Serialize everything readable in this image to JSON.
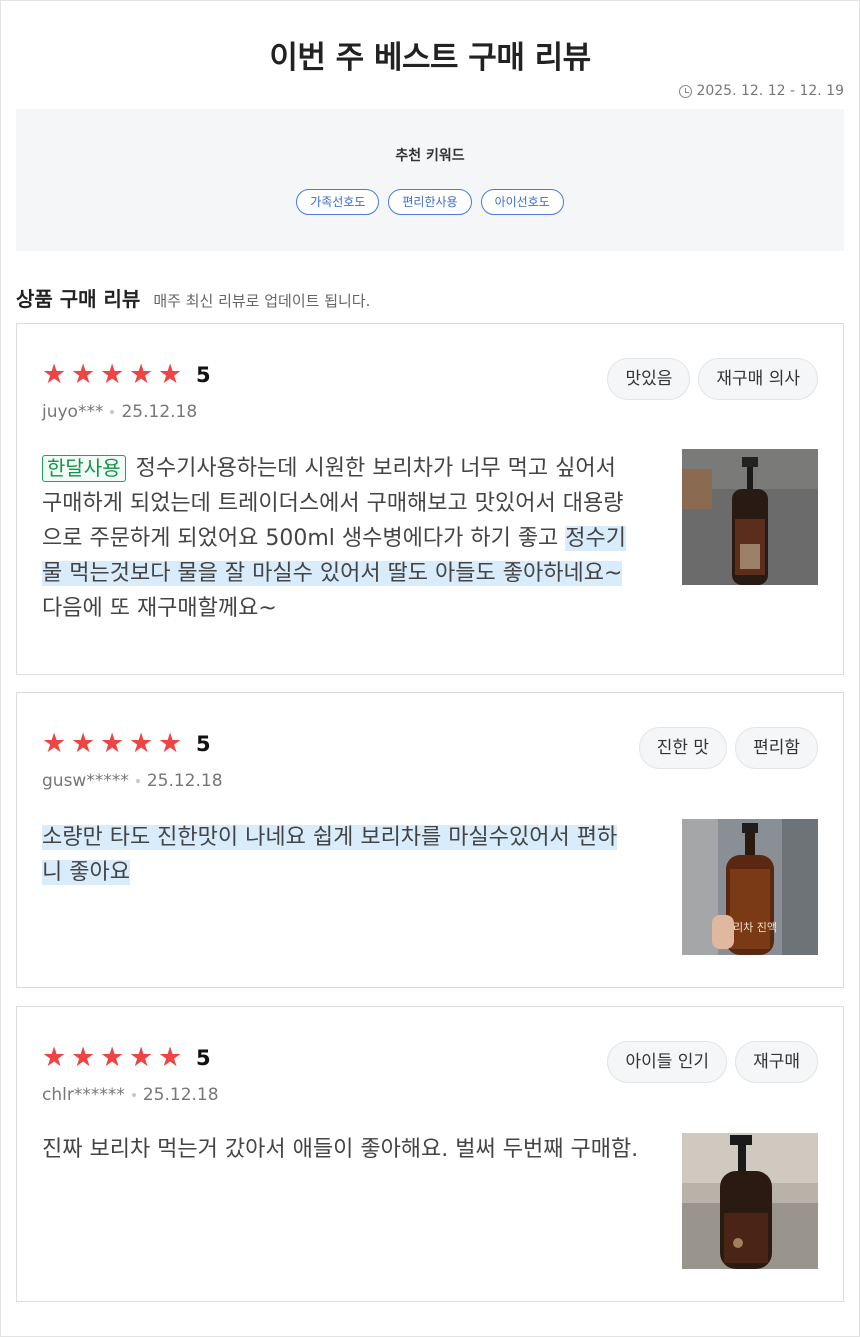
{
  "header": {
    "title": "이번 주 베스트 구매 리뷰",
    "date_range": "2025. 12. 12 - 12. 19",
    "date_icon": "clock-icon"
  },
  "keywords": {
    "title": "추천 키워드",
    "items": [
      "가족선호도",
      "편리한사용",
      "아이선호도"
    ],
    "accent_color": "#3b6ccc"
  },
  "section": {
    "title": "상품 구매 리뷰",
    "subtitle": "매주 최신 리뷰로 업데이트 됩니다."
  },
  "reviews": [
    {
      "rating": "5",
      "stars": "★★★★★",
      "user": "juyo***",
      "date": "25.12.18",
      "tags": [
        "맛있음",
        "재구매 의사"
      ],
      "badge": "한달사용",
      "text_plain": "정수기사용하는데 시원한 보리차가 너무 먹고 싶어서 구매하게 되었는데 트레이더스에서 구매해보고 맛있어서 대용량으로 주문하게 되었어요 500ml 생수병에다가 하기 좋고 ",
      "text_highlight": "정수기 물 먹는것보다 물을 잘 마실수 있어서 딸도 아들도 좋아하네요~",
      "text_after": " 다음에 또 재구매할께요~"
    },
    {
      "rating": "5",
      "stars": "★★★★★",
      "user": "gusw*****",
      "date": "25.12.18",
      "tags": [
        "진한 맛",
        "편리함"
      ],
      "text_highlight": "소량만 타도 진한맛이 나네요 쉽게 보리차를 마실수있어서 편하니 좋아요",
      "bottle_label": "보리차 진액"
    },
    {
      "rating": "5",
      "stars": "★★★★★",
      "user": "chlr******",
      "date": "25.12.18",
      "tags": [
        "아이들 인기",
        "재구매"
      ],
      "text_plain": "진짜 보리차 먹는거 갔아서 애들이 좋아해요. 벌써 두번째 구매함."
    }
  ],
  "colors": {
    "star": "#ef4444",
    "highlight": "#d8ecfb",
    "badge_green": "#15924b"
  }
}
